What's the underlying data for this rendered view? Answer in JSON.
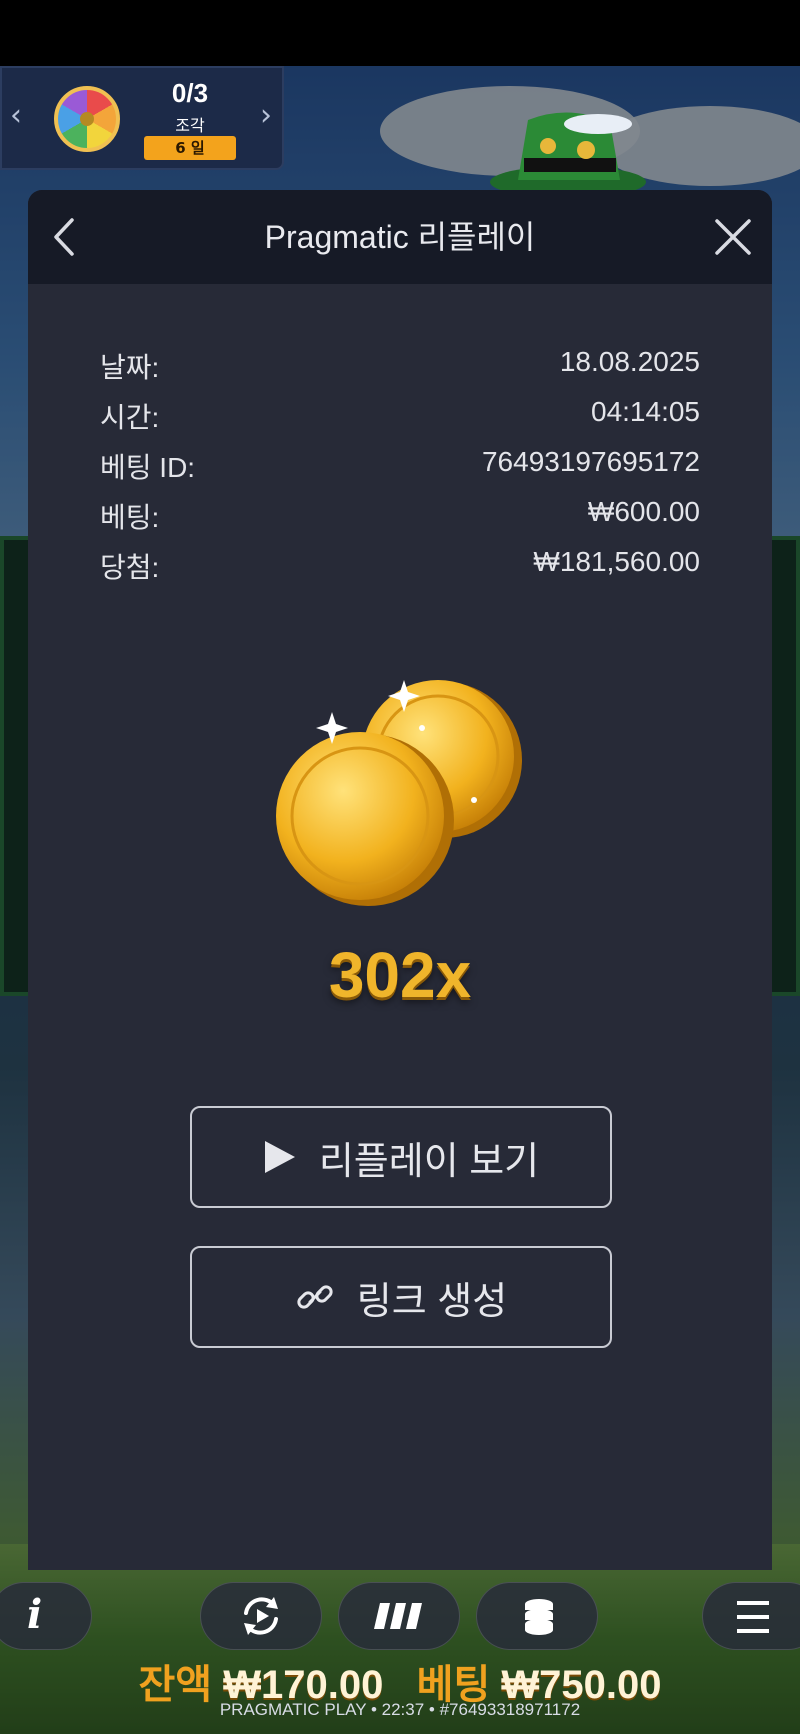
{
  "collection": {
    "count": "0/3",
    "label": "조각",
    "days": "6 일"
  },
  "modal": {
    "title": "Pragmatic 리플레이",
    "rows": [
      {
        "label": "날짜:",
        "value": "18.08.2025"
      },
      {
        "label": "시간:",
        "value": "04:14:05"
      },
      {
        "label": "베팅 ID:",
        "value": "76493197695172"
      },
      {
        "label": "베팅:",
        "value": "₩600.00"
      },
      {
        "label": "당첨:",
        "value": "₩181,560.00"
      }
    ],
    "multiplier": "302x",
    "watch_replay_label": "리플레이 보기",
    "create_link_label": "링크 생성"
  },
  "bottom_bar": {
    "balance_label": "잔액",
    "balance_value": "₩170.00",
    "bet_label": "베팅",
    "bet_value": "₩750.00",
    "footer": "PRAGMATIC PLAY • 22:37 • #76493318971172"
  },
  "colors": {
    "modal_bg": "#272a37",
    "header_bg": "#161a26",
    "accent_gold": "#f0b52b",
    "label_orange": "#f0a11f"
  }
}
